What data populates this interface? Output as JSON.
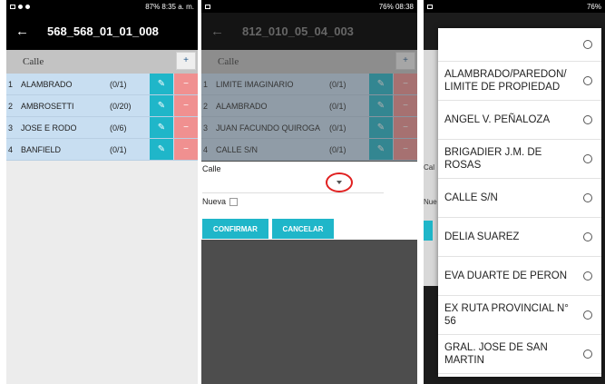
{
  "panel1": {
    "status_left": "",
    "status_right": "87% 8:35 a. m.",
    "title": "568_568_01_01_008",
    "header_label": "Calle",
    "add_label": "+",
    "rows": [
      {
        "num": "1",
        "name": "ALAMBRADO",
        "count": "(0/1)"
      },
      {
        "num": "2",
        "name": "AMBROSETTI",
        "count": "(0/20)"
      },
      {
        "num": "3",
        "name": "JOSE E RODO",
        "count": "(0/6)"
      },
      {
        "num": "4",
        "name": "BANFIELD",
        "count": "(0/1)"
      }
    ]
  },
  "panel2": {
    "status_right": "76% 08:38",
    "title": "812_010_05_04_003",
    "header_label": "Calle",
    "add_label": "+",
    "rows": [
      {
        "num": "1",
        "name": "LIMITE IMAGINARIO",
        "count": "(0/1)"
      },
      {
        "num": "2",
        "name": "ALAMBRADO",
        "count": "(0/1)"
      },
      {
        "num": "3",
        "name": "JUAN FACUNDO QUIROGA",
        "count": "(0/1)"
      },
      {
        "num": "4",
        "name": "CALLE S/N",
        "count": "(0/1)"
      }
    ],
    "form": {
      "calle_label": "Calle",
      "nueva_label": "Nueva",
      "confirm_label": "CONFIRMAR",
      "cancel_label": "CANCELAR"
    }
  },
  "panel3": {
    "status_right": "76%",
    "bg_calle": "Cal",
    "bg_nueva": "Nue",
    "options": [
      "",
      "ALAMBRADO/PAREDON/ LIMITE DE PROPIEDAD",
      "ANGEL V. PEÑALOZA",
      "BRIGADIER J.M. DE ROSAS",
      "CALLE S/N",
      "DELIA SUAREZ",
      "EVA DUARTE DE PERON",
      "EX RUTA PROVINCIAL N° 56",
      "GRAL. JOSE DE SAN MARTIN"
    ]
  },
  "icons": {
    "back": "arrow-left-icon",
    "edit": "pencil-icon",
    "delete": "minus-icon",
    "caret": "caret-down-icon"
  },
  "colors": {
    "accent": "#1fb6c9",
    "delete": "#f09090",
    "row_bg": "#c8def1",
    "highlight_circle": "#e02020"
  }
}
